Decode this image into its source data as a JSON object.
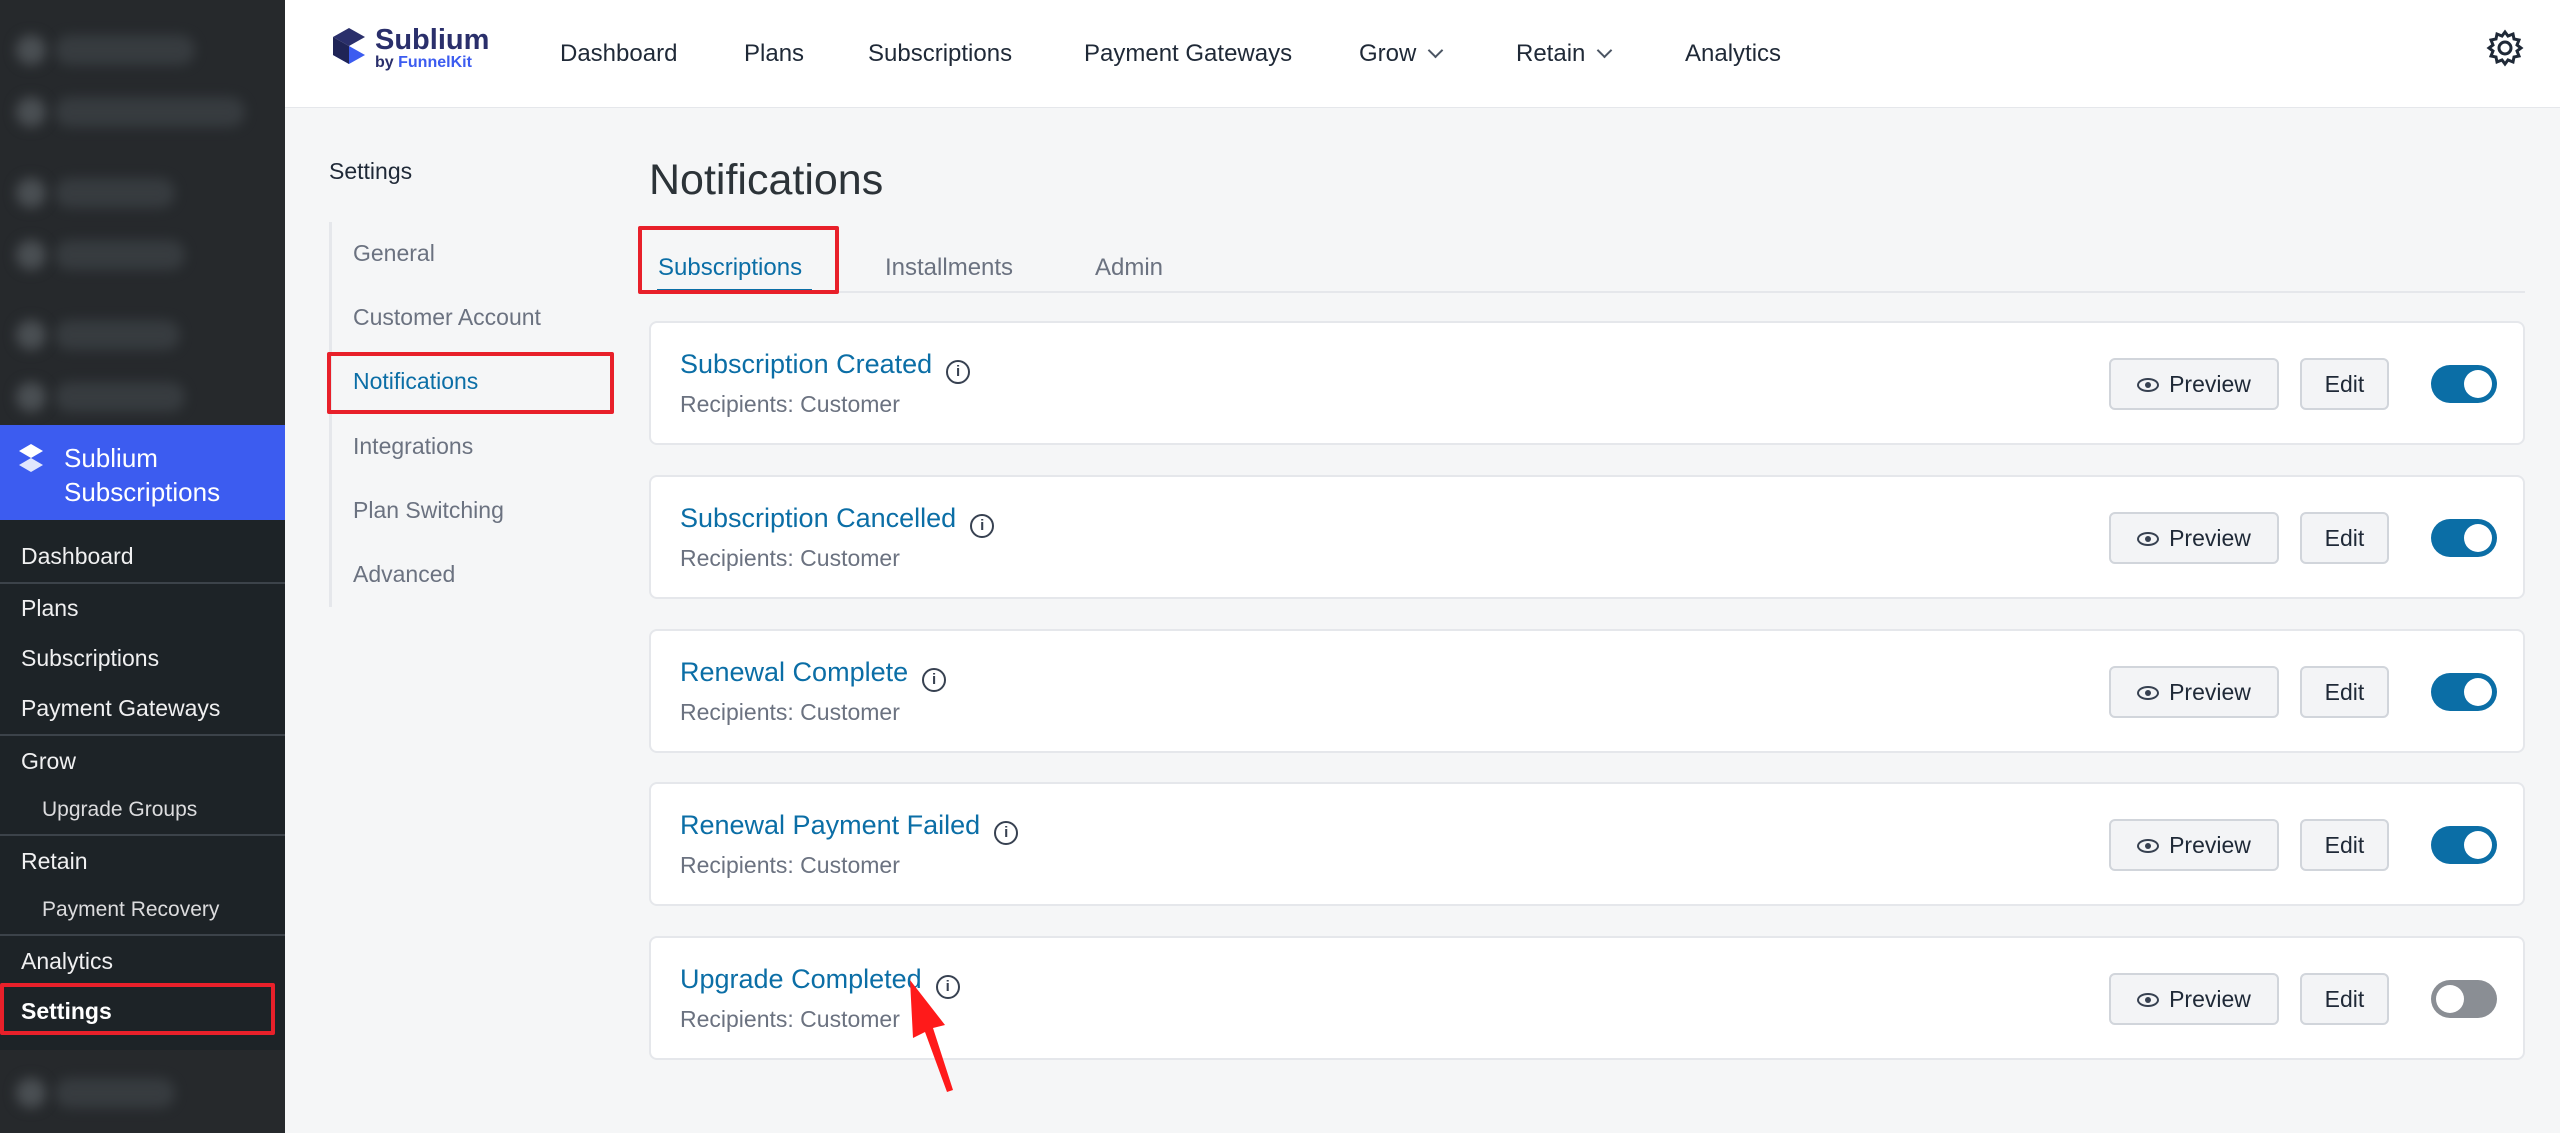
{
  "plugin": {
    "name": "Sublium Subscriptions"
  },
  "brand": {
    "name": "Sublium",
    "by": "by ",
    "by_kit": "FunnelKit"
  },
  "top_nav": {
    "items": [
      "Dashboard",
      "Plans",
      "Subscriptions",
      "Payment Gateways",
      "Grow",
      "Retain",
      "Analytics"
    ],
    "settings_icon": "gear-icon"
  },
  "wp_menu": {
    "dashboard": "Dashboard",
    "plans": "Plans",
    "subscriptions": "Subscriptions",
    "payment_gateways": "Payment Gateways",
    "grow": "Grow",
    "upgrade_groups": "Upgrade Groups",
    "retain": "Retain",
    "payment_recovery": "Payment Recovery",
    "analytics": "Analytics",
    "settings": "Settings"
  },
  "settings_nav": {
    "label": "Settings",
    "items": [
      "General",
      "Customer Account",
      "Notifications",
      "Integrations",
      "Plan Switching",
      "Advanced"
    ],
    "active": "Notifications"
  },
  "page": {
    "title": "Notifications"
  },
  "tabs": {
    "items": [
      "Subscriptions",
      "Installments",
      "Admin"
    ],
    "active": "Subscriptions"
  },
  "notifications": [
    {
      "title": "Subscription Created",
      "recipients": "Recipients: Customer",
      "enabled": true
    },
    {
      "title": "Subscription Cancelled",
      "recipients": "Recipients: Customer",
      "enabled": true
    },
    {
      "title": "Renewal Complete",
      "recipients": "Recipients: Customer",
      "enabled": true
    },
    {
      "title": "Renewal Payment Failed",
      "recipients": "Recipients: Customer",
      "enabled": true
    },
    {
      "title": "Upgrade Completed",
      "recipients": "Recipients: Customer",
      "enabled": false
    }
  ],
  "buttons": {
    "preview": "Preview",
    "edit": "Edit"
  },
  "info_glyph": "i",
  "colors": {
    "accent": "#0b6ea6",
    "plugin_header": "#3c5cf0",
    "highlight": "#e8202a",
    "toggle_off": "#8a8e94"
  }
}
